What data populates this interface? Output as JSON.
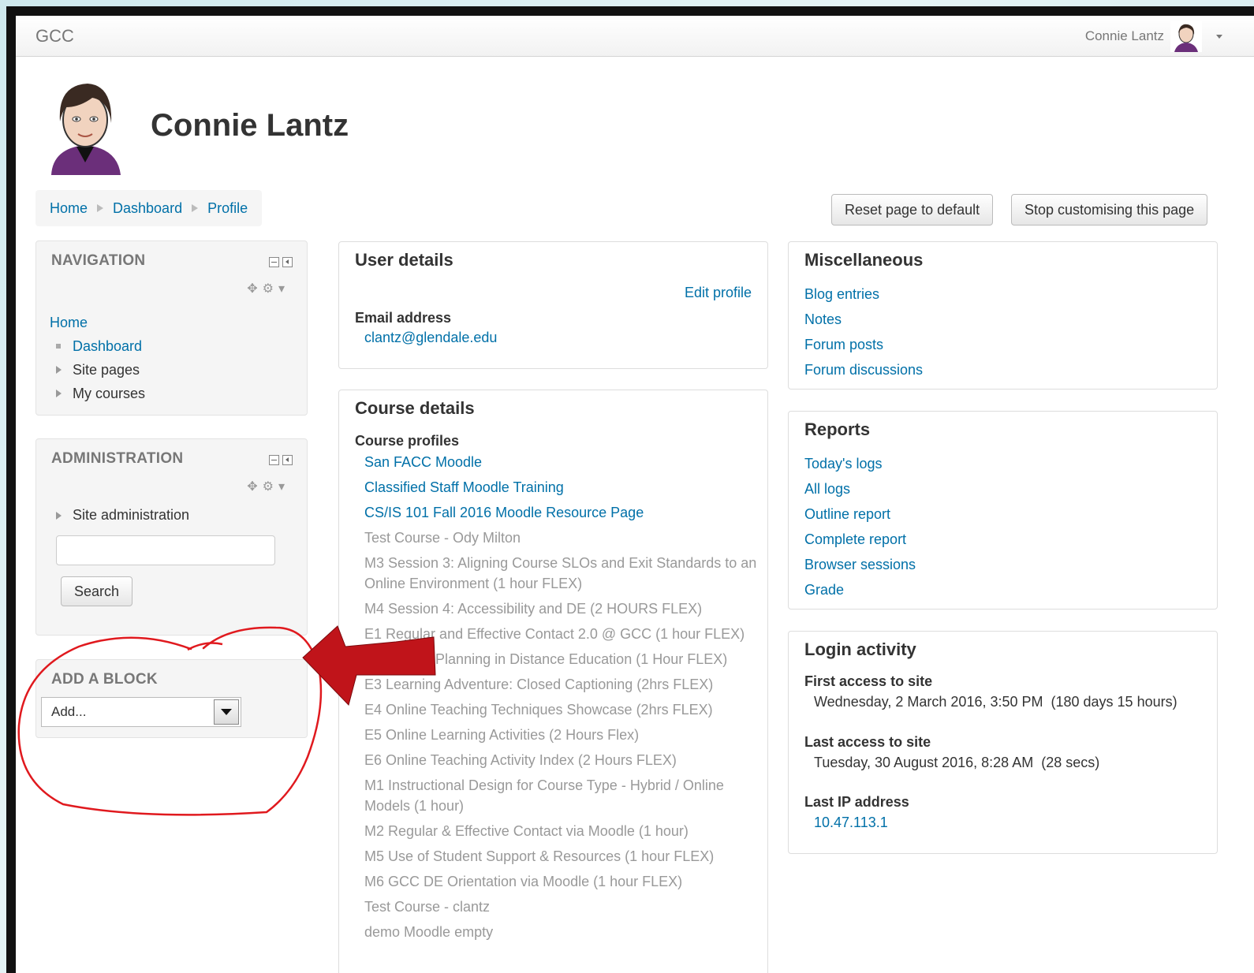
{
  "navbar": {
    "brand": "GCC",
    "user_name": "Connie Lantz"
  },
  "profile": {
    "name": "Connie Lantz"
  },
  "breadcrumb": [
    "Home",
    "Dashboard",
    "Profile"
  ],
  "actions": {
    "reset": "Reset page to default",
    "stop": "Stop customising this page"
  },
  "navigation": {
    "title": "NAVIGATION",
    "home": "Home",
    "items": [
      "Dashboard",
      "Site pages",
      "My courses"
    ]
  },
  "administration": {
    "title": "ADMINISTRATION",
    "site_admin": "Site administration",
    "search_value": "",
    "search_button": "Search"
  },
  "add_block": {
    "title": "ADD A BLOCK",
    "selected": "Add..."
  },
  "user_details": {
    "title": "User details",
    "edit_profile": "Edit profile",
    "email_label": "Email address",
    "email": "clantz@glendale.edu"
  },
  "course_details": {
    "title": "Course details",
    "profiles_label": "Course profiles",
    "courses": [
      {
        "name": "San FACC Moodle",
        "active": true
      },
      {
        "name": "Classified Staff Moodle Training",
        "active": true
      },
      {
        "name": "CS/IS 101 Fall 2016 Moodle Resource Page",
        "active": true
      },
      {
        "name": "Test Course - Ody Milton",
        "active": false
      },
      {
        "name": "M3 Session 3: Aligning Course SLOs and Exit Standards to an Online Environment (1 hour FLEX)",
        "active": false
      },
      {
        "name": "M4 Session 4: Accessibility and DE (2 HOURS FLEX)",
        "active": false
      },
      {
        "name": "E1 Regular and Effective Contact 2.0 @ GCC (1 hour FLEX)",
        "active": false
      },
      {
        "name": "E2 Course Planning in Distance Education (1 Hour FLEX)",
        "active": false
      },
      {
        "name": "E3 Learning Adventure: Closed Captioning (2hrs FLEX)",
        "active": false
      },
      {
        "name": "E4 Online Teaching Techniques Showcase (2hrs FLEX)",
        "active": false
      },
      {
        "name": "E5 Online Learning Activities (2 Hours Flex)",
        "active": false
      },
      {
        "name": "E6 Online Teaching Activity Index (2 Hours FLEX)",
        "active": false
      },
      {
        "name": "M1 Instructional Design for Course Type - Hybrid / Online Models (1 hour)",
        "active": false
      },
      {
        "name": "M2 Regular & Effective Contact via Moodle (1 hour)",
        "active": false
      },
      {
        "name": "M5 Use of Student Support & Resources (1 hour FLEX)",
        "active": false
      },
      {
        "name": "M6 GCC DE Orientation via Moodle (1 hour FLEX)",
        "active": false
      },
      {
        "name": "Test Course - clantz",
        "active": false
      },
      {
        "name": "demo Moodle empty",
        "active": false
      }
    ]
  },
  "miscellaneous": {
    "title": "Miscellaneous",
    "links": [
      "Blog entries",
      "Notes",
      "Forum posts",
      "Forum discussions"
    ]
  },
  "reports": {
    "title": "Reports",
    "links": [
      "Today's logs",
      "All logs",
      "Outline report",
      "Complete report",
      "Browser sessions",
      "Grade"
    ]
  },
  "login_activity": {
    "title": "Login activity",
    "first_label": "First access to site",
    "first_value": "Wednesday, 2 March 2016, 3:50 PM  (180 days 15 hours)",
    "last_label": "Last access to site",
    "last_value": "Tuesday, 30 August 2016, 8:28 AM  (28 secs)",
    "ip_label": "Last IP address",
    "ip_value": "10.47.113.1"
  },
  "annotation": {
    "circle_color": "#e0191e",
    "arrow_color": "#c0141a"
  }
}
